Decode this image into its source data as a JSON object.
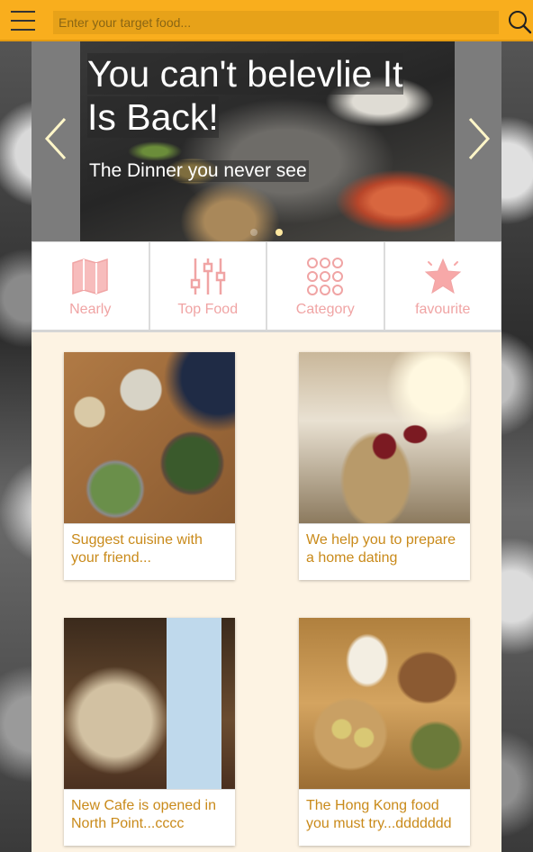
{
  "topbar": {
    "search_placeholder": "Enter your target food...",
    "accent_color": "#f9ae1d",
    "menu_icon": "hamburger-menu-icon",
    "search_icon": "magnifier-icon"
  },
  "carousel": {
    "headline": "You can't belevlie It Is Back!",
    "subline": "The Dinner you never see",
    "slide_count": 2,
    "active_slide": 2
  },
  "nav": {
    "items": [
      {
        "label": "Nearly",
        "icon": "map-icon"
      },
      {
        "label": "Top Food",
        "icon": "sliders-icon"
      },
      {
        "label": "Category",
        "icon": "grid-dots-icon"
      },
      {
        "label": "favourite",
        "icon": "star-icon"
      }
    ]
  },
  "cards": [
    {
      "text": "Suggest cuisine with your friend..."
    },
    {
      "text": "We help you to prepare a home dating"
    },
    {
      "text": "New Cafe is opened in North Point...cccc"
    },
    {
      "text": "The Hong Kong food you must try...ddddddd"
    }
  ]
}
